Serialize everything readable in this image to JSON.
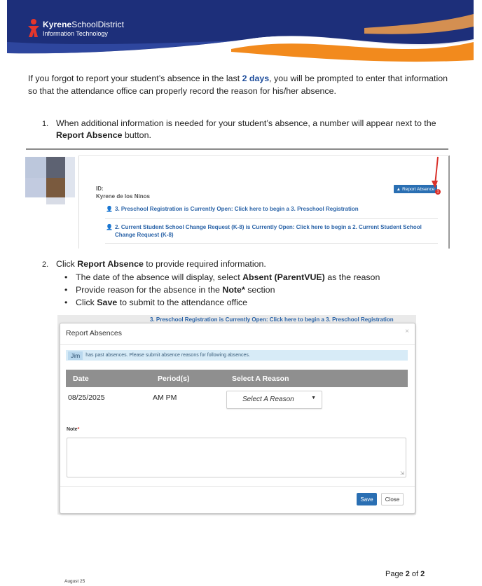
{
  "header": {
    "brand_bold": "Kyrene",
    "brand_rest": "SchoolDistrict",
    "department": "Information Technology",
    "colors": {
      "navy": "#1d2f7a",
      "orange": "#f28a1d",
      "red": "#e5362c"
    }
  },
  "intro": {
    "before": "If you forgot to report your student’s absence in the last ",
    "highlight": "2 days",
    "after": ", you will be prompted to enter that information so that the attendance office can properly record the reason for his/her absence."
  },
  "step1": {
    "number": "1.",
    "text": "When additional information is needed for your student’s absence, a number will appear next to the ",
    "bold": "Report Absence",
    "after": " button."
  },
  "screenshot1": {
    "id_label": "ID:",
    "student_name": "Kyrene de los Ninos",
    "button_label": "Report Absence",
    "badge_count": "1",
    "links": [
      "3. Preschool Registration is Currently Open: Click here to begin a 3. Preschool Registration",
      "2. Current Student School Change Request (K-8) is Currently Open: Click here to begin a 2. Current Student School Change Request (K-8)"
    ]
  },
  "step2": {
    "number": "2.",
    "before": "Click ",
    "bold": "Report Absence",
    "after": " to provide required information.",
    "bullets": [
      {
        "before": "The date of the absence will display, select ",
        "bold": "Absent (ParentVUE)",
        "after": " as the reason"
      },
      {
        "before": "Provide reason for the absence in the ",
        "bold": "Note*",
        "after": " section"
      },
      {
        "before": "Click ",
        "bold": "Save",
        "after": " to submit to the attendance office"
      }
    ]
  },
  "modal": {
    "behind_text": "3. Preschool Registration is Currently Open: Click here to begin a 3. Preschool Registration",
    "title": "Report Absences",
    "close_symbol": "×",
    "alert_name": "Jim",
    "alert_text": "has past absences. Please submit absence reasons for following absences.",
    "columns": [
      "Date",
      "Period(s)",
      "Select A Reason"
    ],
    "row": {
      "date": "08/25/2025",
      "periods": "AM PM"
    },
    "select_label": "Select A Reason",
    "note_label": "Note",
    "note_required": "*",
    "save_label": "Save",
    "close_label": "Close"
  },
  "footer": {
    "page_before": "Page ",
    "page_current": "2",
    "page_mid": " of ",
    "page_total": "2",
    "date": "August 25"
  }
}
